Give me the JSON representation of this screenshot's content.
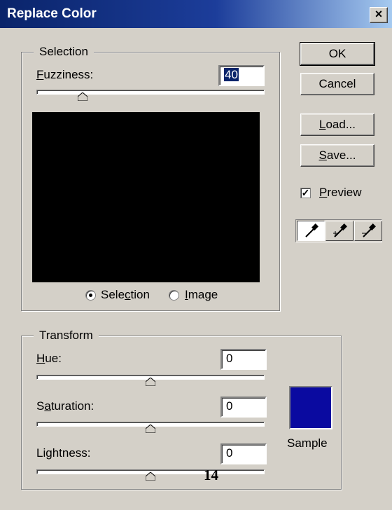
{
  "dialog": {
    "title": "Replace Color",
    "close": "×"
  },
  "selection": {
    "legend": "Selection",
    "fuzziness": {
      "prefix": "",
      "ul": "F",
      "rest": "uzziness:",
      "value": "40",
      "slider_fraction": 0.197
    },
    "radios": [
      {
        "pre": "Sele",
        "ul": "c",
        "post": "tion",
        "checked": true
      },
      {
        "pre": "",
        "ul": "I",
        "post": "mage",
        "checked": false
      }
    ]
  },
  "transform": {
    "legend": "Transform",
    "hue": {
      "ul": "H",
      "rest": "ue:",
      "value": "0",
      "slider_fraction": 0.5
    },
    "saturation": {
      "pre": "S",
      "ul": "a",
      "rest": "turation:",
      "value": "0",
      "slider_fraction": 0.5
    },
    "lightness": {
      "pre": "Li",
      "ul": "g",
      "rest": "htness:",
      "value": "0",
      "slider_fraction": 0.5
    },
    "sample_label": "Sample",
    "sample_color": "#0a0aa0"
  },
  "buttons": {
    "ok": "OK",
    "cancel": "Cancel",
    "load": {
      "ul": "L",
      "rest": "oad..."
    },
    "save": {
      "ul": "S",
      "rest": "ave..."
    }
  },
  "preview": {
    "ul": "P",
    "rest": "review",
    "checked": true
  },
  "tools": [
    "eyedropper-icon",
    "eyedropper-plus-icon",
    "eyedropper-minus-icon"
  ],
  "page_number": "14"
}
